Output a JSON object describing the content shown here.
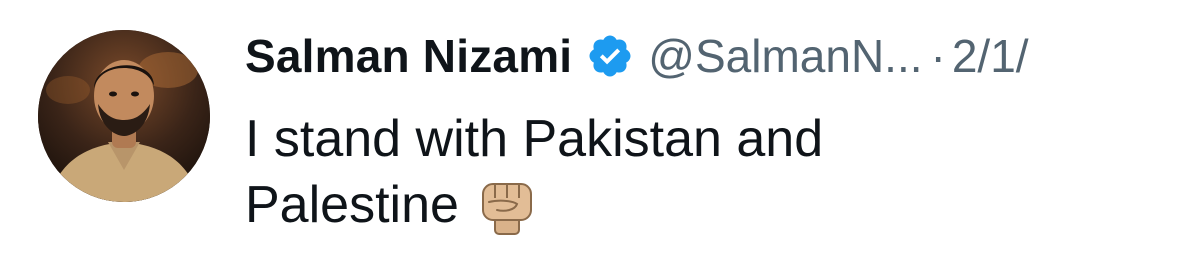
{
  "tweet": {
    "author": {
      "display_name": "Salman Nizami",
      "handle": "@SalmanN...",
      "verified": true,
      "avatar_icon": "profile-photo"
    },
    "separator": "·",
    "date": "2/1/",
    "text_line_1": "I stand with Pakistan and",
    "text_line_2": "Palestine",
    "emoji": "raised-fist-medium-light-skin-tone",
    "colors": {
      "text": "#0f1419",
      "secondary": "#536471",
      "verified_badge": "#1d9bf0"
    }
  }
}
